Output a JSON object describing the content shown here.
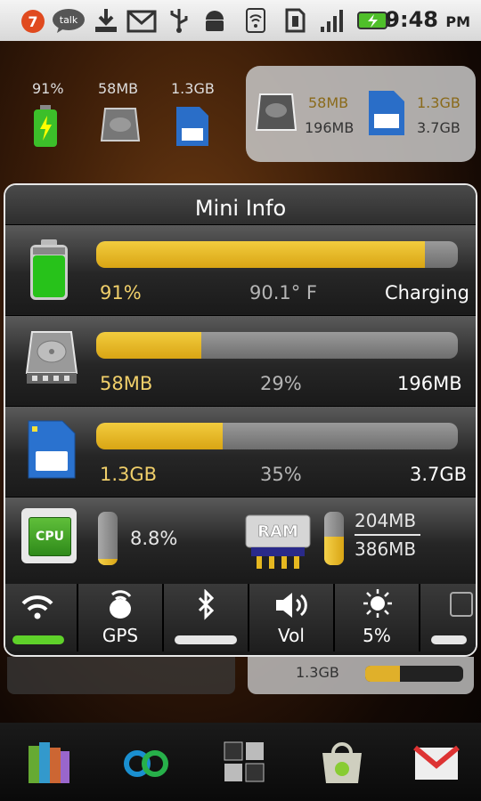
{
  "status_bar": {
    "notification_count": "7",
    "talk_label": "talk",
    "time": "9:48",
    "ampm": "PM",
    "icons": [
      "notification-badge-icon",
      "talk-icon",
      "download-icon",
      "gmail-icon",
      "usb-icon",
      "android-debug-icon",
      "wifi-icon",
      "sim-card-icon",
      "signal-icon",
      "battery-charging-icon"
    ]
  },
  "background_widget": {
    "battery": "91%",
    "internal": "58MB",
    "sd": "1.3GB",
    "panel": {
      "internal_used": "58MB",
      "internal_total": "196MB",
      "sd_used": "1.3GB",
      "sd_total": "3.7GB"
    },
    "lower_sd": "1.3GB"
  },
  "dialog": {
    "title": "Mini Info",
    "battery": {
      "level_label": "91%",
      "level": 0.91,
      "temperature": "90.1° F",
      "status": "Charging"
    },
    "internal": {
      "used": "58MB",
      "percent_label": "29%",
      "percent": 0.29,
      "total": "196MB"
    },
    "sd": {
      "used": "1.3GB",
      "percent_label": "35%",
      "percent": 0.35,
      "total": "3.7GB"
    },
    "cpu": {
      "label": "CPU",
      "usage": "8.8%",
      "level": 0.088
    },
    "ram": {
      "label": "RAM",
      "used": "204MB",
      "total": "386MB",
      "level": 0.53
    },
    "toggles": [
      {
        "name": "wifi",
        "label": "",
        "state_color": "#5fd12a"
      },
      {
        "name": "gps",
        "label": "GPS"
      },
      {
        "name": "bluetooth",
        "label": "",
        "state_color": "#e6e6e6"
      },
      {
        "name": "volume",
        "label": "Vol"
      },
      {
        "name": "brightness",
        "label": "5%"
      },
      {
        "name": "auto-rotate",
        "label": "",
        "state_color": "#e6e6e6"
      }
    ]
  },
  "dock": {
    "icons": [
      "books-icon",
      "infinity-app-icon",
      "launcher-grid-icon",
      "market-icon",
      "gmail-app-icon"
    ]
  },
  "colors": {
    "accent": "#e0b02a",
    "dialog_bg": "#1c1c1c",
    "status_bar": "#e8e8e8"
  }
}
